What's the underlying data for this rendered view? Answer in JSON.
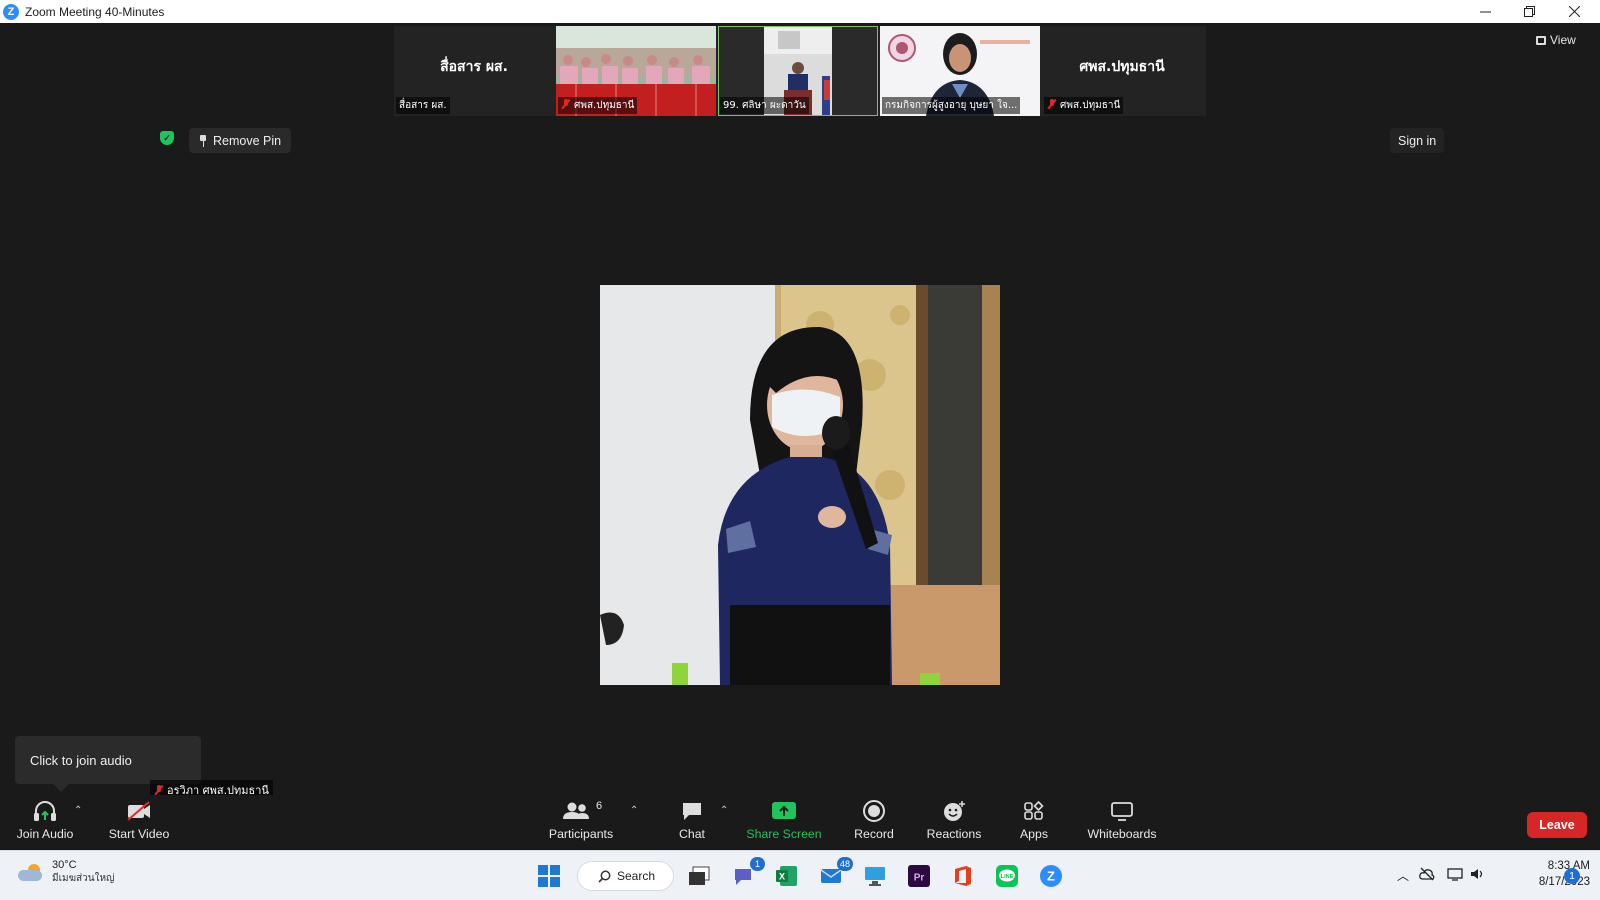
{
  "window": {
    "title": "Zoom Meeting 40-Minutes",
    "app_logo_letter": "Z"
  },
  "strip": {
    "tiles": [
      {
        "big_name": "สื่อสาร ผส.",
        "name": "สื่อสาร ผส.",
        "muted": false,
        "type": "text"
      },
      {
        "big_name": "",
        "name": "ศพส.ปทุมธานี",
        "muted": true,
        "type": "video-audience"
      },
      {
        "big_name": "",
        "name": "99. ศลิษา ผะดาวัน",
        "muted": false,
        "type": "video-podium",
        "active": true
      },
      {
        "big_name": "",
        "name": "กรมกิจการผู้สูงอายุ บุษยา ใจ...",
        "muted": false,
        "type": "video-woman"
      },
      {
        "big_name": "ศพส.ปทุมธานี",
        "name": "ศพส.ปทุมธานี",
        "muted": true,
        "type": "text"
      }
    ]
  },
  "view_label": "View",
  "remove_pin_label": "Remove Pin",
  "sign_in_label": "Sign in",
  "tooltip": {
    "text": "Click to join audio"
  },
  "self_view": {
    "name": "อรวิภา ศพส.ปทุมธานี"
  },
  "toolbar": {
    "join_audio": "Join Audio",
    "start_video": "Start Video",
    "participants": "Participants",
    "participants_count": "6",
    "chat": "Chat",
    "share_screen": "Share Screen",
    "record": "Record",
    "reactions": "Reactions",
    "apps": "Apps",
    "whiteboards": "Whiteboards",
    "leave": "Leave"
  },
  "taskbar": {
    "weather_temp": "30°C",
    "weather_desc": "มีเมฆส่วนใหญ่",
    "search_label": "Search",
    "teams_badge": "1",
    "mail_badge": "48",
    "time": "8:33 AM",
    "date": "8/17/2023",
    "notification_count": "1"
  },
  "colors": {
    "share_screen": "#21c45c",
    "leave": "#d72626",
    "zoom_blue": "#2d8cff",
    "muted_red": "#e02828"
  }
}
